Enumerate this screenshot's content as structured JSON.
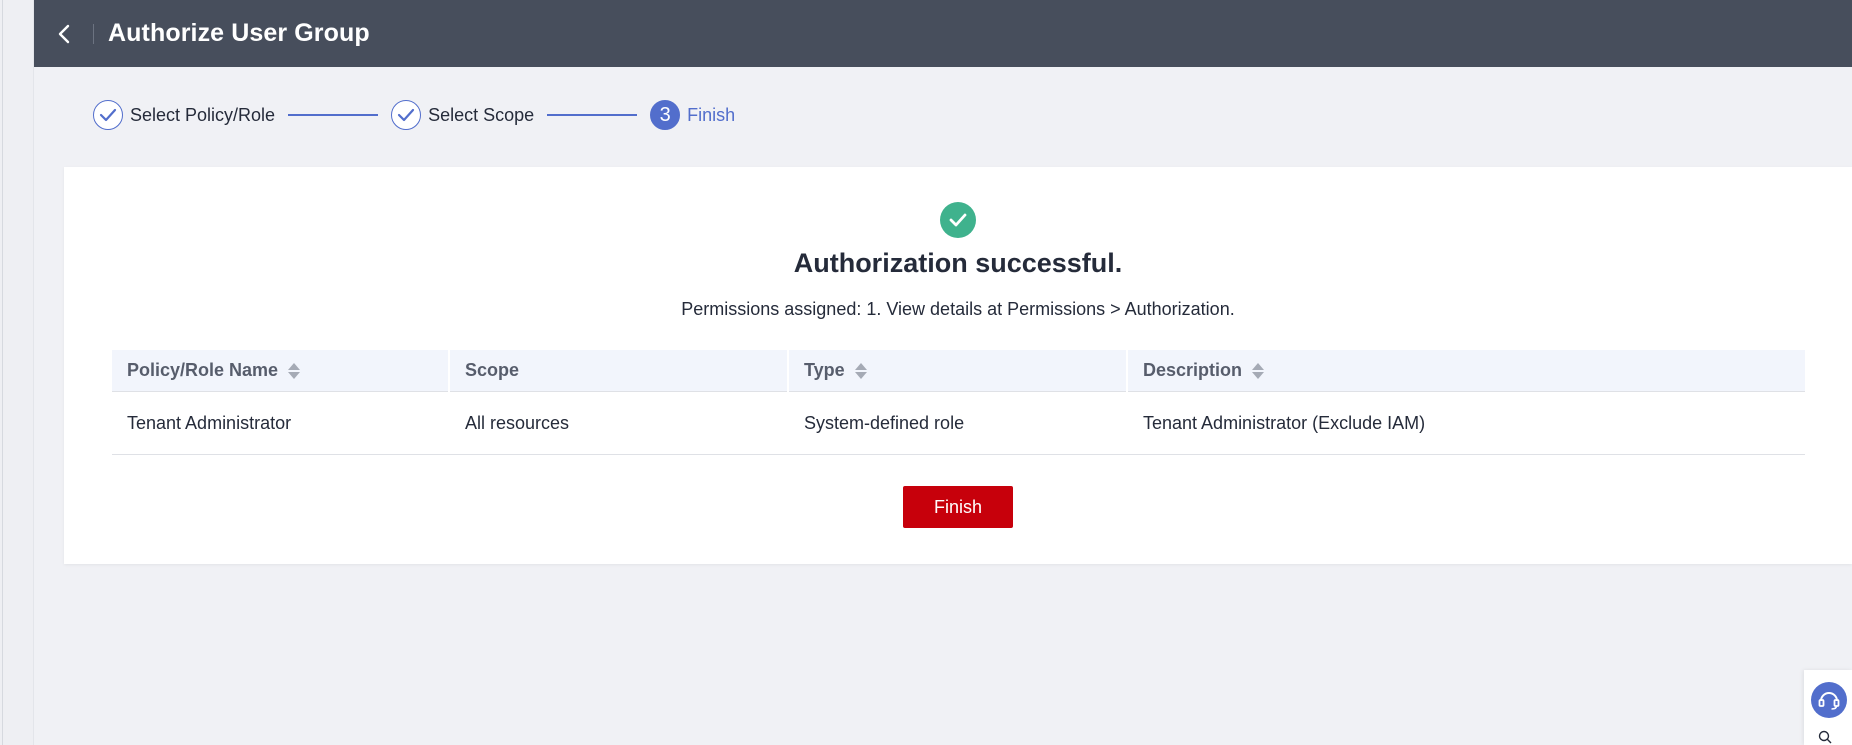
{
  "header": {
    "title": "Authorize User Group"
  },
  "steps": [
    {
      "label": "Select Policy/Role",
      "state": "done"
    },
    {
      "label": "Select Scope",
      "state": "done"
    },
    {
      "label": "Finish",
      "state": "active",
      "number": "3"
    }
  ],
  "result": {
    "title": "Authorization successful.",
    "description": "Permissions assigned: 1. View details at Permissions > Authorization."
  },
  "table": {
    "columns": [
      {
        "label": "Policy/Role Name",
        "sortable": true
      },
      {
        "label": "Scope",
        "sortable": false
      },
      {
        "label": "Type",
        "sortable": true
      },
      {
        "label": "Description",
        "sortable": true
      }
    ],
    "rows": [
      {
        "name": "Tenant Administrator",
        "scope": "All resources",
        "type": "System-defined role",
        "description": "Tenant Administrator (Exclude IAM)"
      }
    ]
  },
  "actions": {
    "finish_label": "Finish"
  },
  "colors": {
    "header_bg": "#474e5c",
    "accent": "#526ecc",
    "success": "#3fb28d",
    "primary_button": "#c7000b"
  },
  "icons": [
    "back-arrow-icon",
    "check-icon",
    "success-check-icon",
    "sort-icon",
    "customer-service-icon",
    "search-icon"
  ]
}
